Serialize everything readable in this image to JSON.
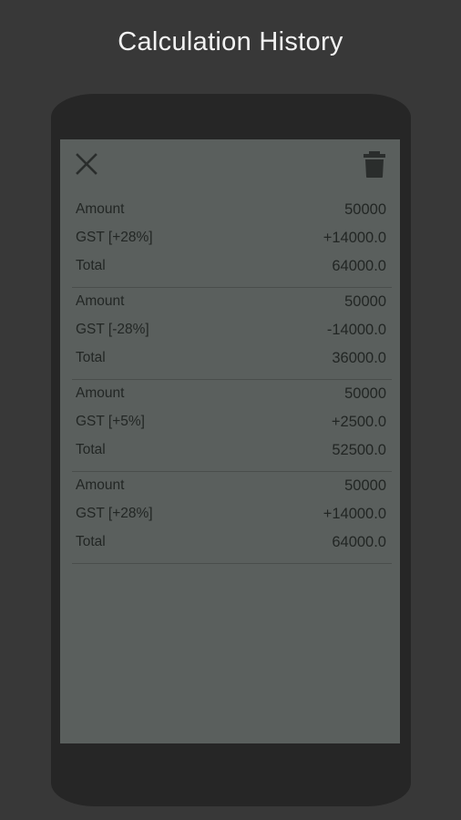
{
  "page": {
    "title": "Calculation History"
  },
  "toolbar": {
    "close_icon": "close-icon",
    "delete_icon": "trash-icon"
  },
  "history": [
    {
      "amount_label": "Amount",
      "amount_value": "50000",
      "gst_label": "GST [+28%]",
      "gst_value": "+14000.0",
      "total_label": "Total",
      "total_value": "64000.0"
    },
    {
      "amount_label": "Amount",
      "amount_value": "50000",
      "gst_label": "GST [-28%]",
      "gst_value": "-14000.0",
      "total_label": "Total",
      "total_value": "36000.0"
    },
    {
      "amount_label": "Amount",
      "amount_value": "50000",
      "gst_label": "GST [+5%]",
      "gst_value": "+2500.0",
      "total_label": "Total",
      "total_value": "52500.0"
    },
    {
      "amount_label": "Amount",
      "amount_value": "50000",
      "gst_label": "GST [+28%]",
      "gst_value": "+14000.0",
      "total_label": "Total",
      "total_value": "64000.0"
    }
  ],
  "colors": {
    "background": "#383838",
    "device": "#262626",
    "screen": "#5a5f5d",
    "text": "#222624",
    "title": "#f2f2f2"
  }
}
